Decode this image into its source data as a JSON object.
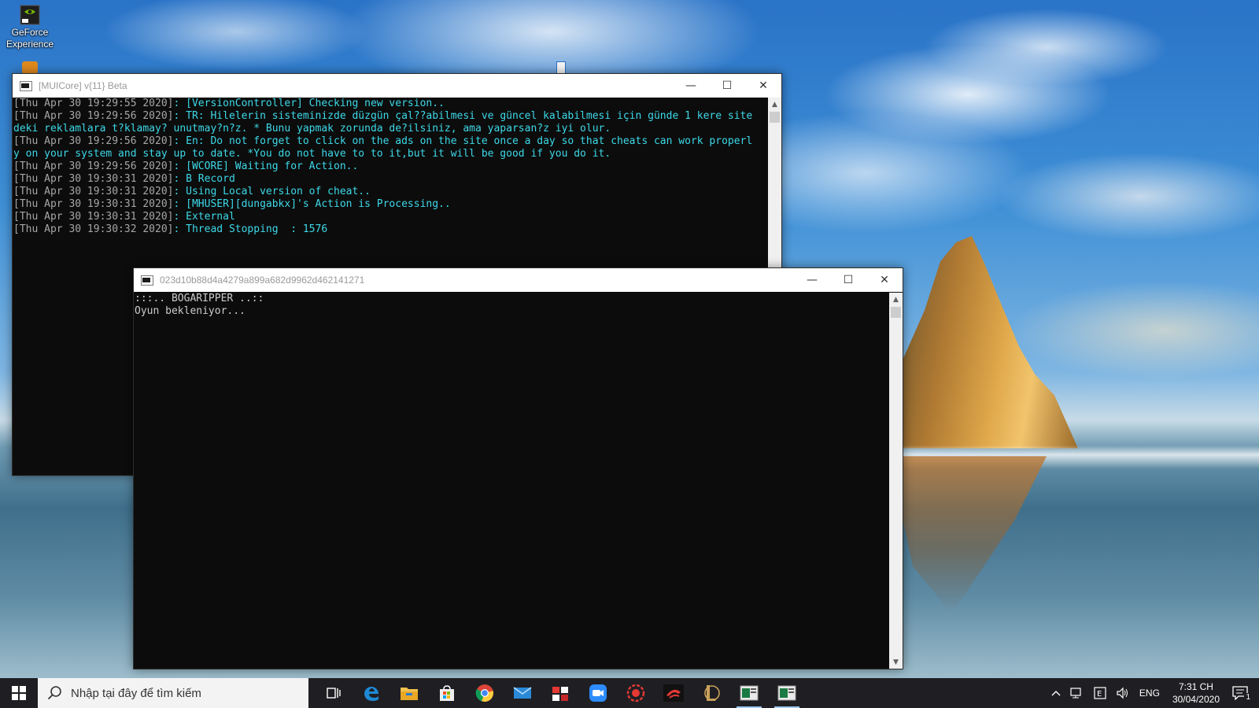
{
  "desktop": {
    "icons": [
      {
        "label_line1": "GeForce",
        "label_line2": "Experience",
        "icon": "geforce-icon"
      }
    ]
  },
  "window_mui": {
    "title": "[MUICore] v{11} Beta",
    "lines": [
      {
        "ts": "[Thu Apr 30 19:29:55 2020]",
        "msg": ": [VersionController] Checking new version.."
      },
      {
        "ts": "[Thu Apr 30 19:29:56 2020]",
        "msg": ": TR: Hilelerin sisteminizde düzgün çal??abilmesi ve güncel kalabilmesi için günde 1 kere site"
      },
      {
        "ts": "",
        "msg": "deki reklamlara t?klamay? unutmay?n?z. * Bunu yapmak zorunda de?ilsiniz, ama yaparsan?z iyi olur."
      },
      {
        "ts": "[Thu Apr 30 19:29:56 2020]",
        "msg": ": En: Do not forget to click on the ads on the site once a day so that cheats can work properl"
      },
      {
        "ts": "",
        "msg": "y on your system and stay up to date. *You do not have to to it,but it will be good if you do it."
      },
      {
        "ts": "[Thu Apr 30 19:29:56 2020]",
        "msg": ": [WCORE] Waiting for Action.."
      },
      {
        "ts": "[Thu Apr 30 19:30:31 2020]",
        "msg": ": B Record"
      },
      {
        "ts": "[Thu Apr 30 19:30:31 2020]",
        "msg": ": Using Local version of cheat.."
      },
      {
        "ts": "[Thu Apr 30 19:30:31 2020]",
        "msg": ": [MHUSER][dungabkx]'s Action is Processing.."
      },
      {
        "ts": "[Thu Apr 30 19:30:31 2020]",
        "msg": ": External"
      },
      {
        "ts": "[Thu Apr 30 19:30:32 2020]",
        "msg": ": Thread Stopping  : 1576"
      }
    ]
  },
  "window_boga": {
    "title": "023d10b88d4a4279a899a682d9962d462141271",
    "lines": [
      ":::.. BOGARIPPER ..::",
      "Oyun bekleniyor..."
    ]
  },
  "caption_buttons": {
    "minimize": "—",
    "maximize": "☐",
    "close": "✕"
  },
  "taskbar": {
    "search_placeholder": "Nhập tại đây để tìm kiếm",
    "apps": [
      {
        "name": "task-view",
        "icon": "task-view-icon"
      },
      {
        "name": "edge",
        "icon": "edge-icon"
      },
      {
        "name": "file-explorer",
        "icon": "folder-icon"
      },
      {
        "name": "store",
        "icon": "store-icon"
      },
      {
        "name": "chrome",
        "icon": "chrome-icon"
      },
      {
        "name": "mail",
        "icon": "mail-icon"
      },
      {
        "name": "app-puzzle",
        "icon": "puzzle-icon"
      },
      {
        "name": "zoom",
        "icon": "zoom-icon"
      },
      {
        "name": "app-red",
        "icon": "red-gear-icon"
      },
      {
        "name": "garena",
        "icon": "garena-icon"
      },
      {
        "name": "league",
        "icon": "league-icon"
      },
      {
        "name": "console-1",
        "icon": "console-icon"
      },
      {
        "name": "console-2",
        "icon": "console-icon"
      }
    ],
    "tray": {
      "language": "ENG",
      "time": "7:31 CH",
      "date": "30/04/2020",
      "notification_count": "1"
    }
  },
  "colors": {
    "console_bg": "#0c0c0c",
    "console_ts": "#a6a6a6",
    "console_msg": "#3dd9e8",
    "console_plain": "#cccccc",
    "taskbar_bg": "#1f1f23"
  }
}
